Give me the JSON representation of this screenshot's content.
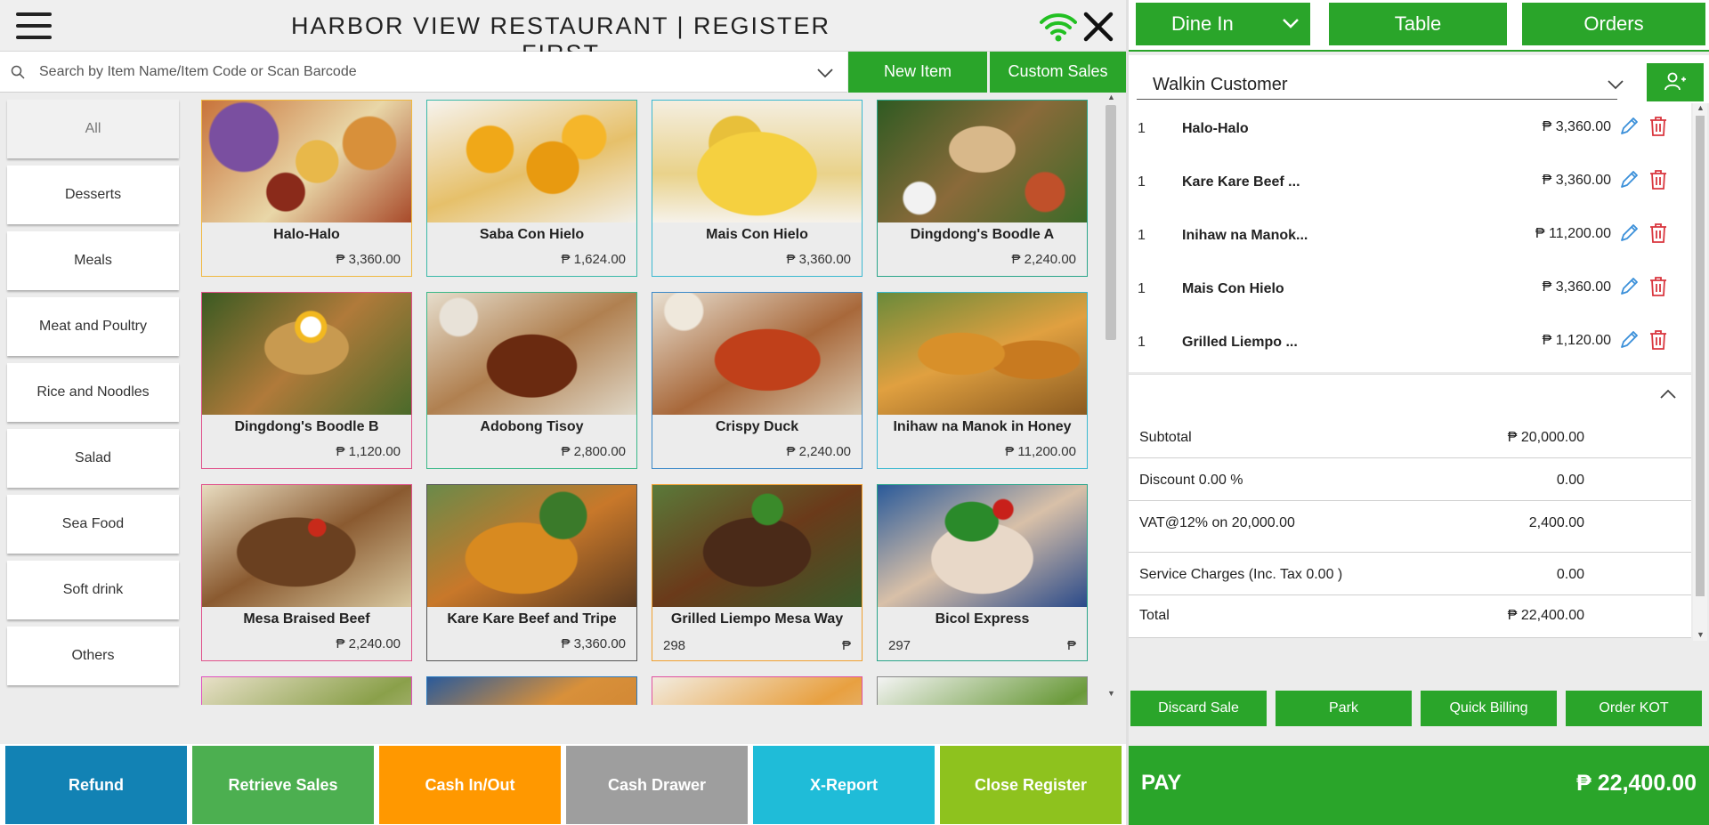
{
  "header": {
    "title": "HARBOR VIEW RESTAURANT | REGISTER FIRST"
  },
  "search": {
    "placeholder": "Search by Item Name/Item Code or Scan Barcode",
    "value": ""
  },
  "toolbar": {
    "new_item": "New Item",
    "custom_sales": "Custom Sales"
  },
  "categories": [
    "All",
    "Desserts",
    "Meals",
    "Meat and Poultry",
    "Rice and Noodles",
    "Salad",
    "Sea Food",
    "Soft drink",
    "Others"
  ],
  "items": [
    {
      "name": "Halo-Halo",
      "price": "₱ 3,360.00"
    },
    {
      "name": "Saba Con Hielo",
      "price": "₱ 1,624.00"
    },
    {
      "name": "Mais Con Hielo",
      "price": "₱ 3,360.00"
    },
    {
      "name": "Dingdong's Boodle A",
      "price": "₱ 2,240.00"
    },
    {
      "name": "Dingdong's Boodle B",
      "price": "₱ 1,120.00"
    },
    {
      "name": "Adobong Tisoy",
      "price": "₱ 2,800.00"
    },
    {
      "name": "Crispy Duck",
      "price": "₱ 2,240.00"
    },
    {
      "name": "Inihaw na Manok in Honey",
      "price": "₱ 11,200.00"
    },
    {
      "name": "Mesa Braised Beef",
      "price": "₱ 2,240.00"
    },
    {
      "name": "Kare Kare Beef and Tripe",
      "price": "₱ 3,360.00"
    },
    {
      "name": "Grilled Liempo Mesa Way",
      "code": "298",
      "currency": "₱"
    },
    {
      "name": "Bicol Express",
      "code": "297",
      "currency": "₱"
    }
  ],
  "actions": {
    "refund": "Refund",
    "retrieve_sales": "Retrieve Sales",
    "cash_in_out": "Cash In/Out",
    "cash_drawer": "Cash Drawer",
    "x_report": "X-Report",
    "close_register": "Close Register"
  },
  "order": {
    "mode": "Dine In",
    "table": "Table",
    "orders": "Orders",
    "customer": "Walkin Customer",
    "lines": [
      {
        "qty": "1",
        "name": "Halo-Halo",
        "price": "₱ 3,360.00"
      },
      {
        "qty": "1",
        "name": "Kare Kare Beef ...",
        "price": "₱ 3,360.00"
      },
      {
        "qty": "1",
        "name": "Inihaw na Manok...",
        "price": "₱ 11,200.00"
      },
      {
        "qty": "1",
        "name": "Mais Con Hielo",
        "price": "₱ 3,360.00"
      },
      {
        "qty": "1",
        "name": "Grilled Liempo ...",
        "price": "₱ 1,120.00"
      }
    ],
    "totals": {
      "subtotal_label": "Subtotal",
      "subtotal": "₱ 20,000.00",
      "discount_label": "Discount 0.00 %",
      "discount": "0.00",
      "vat_label": "VAT@12% on 20,000.00",
      "vat": "2,400.00",
      "service_label": "Service Charges (Inc. Tax 0.00 )",
      "service": "0.00",
      "total_label": "Total",
      "total": "₱ 22,400.00"
    },
    "buttons": {
      "discard": "Discard Sale",
      "park": "Park",
      "quick_billing": "Quick Billing",
      "order_kot": "Order KOT"
    },
    "pay_label": "PAY",
    "pay_amount": "₱ 22,400.00"
  },
  "colors": {
    "accent": "#2aa52a",
    "refund": "#1282b4",
    "retrieve": "#4caf50",
    "cash_in_out": "#ff9800",
    "cash_drawer": "#9e9e9e",
    "x_report": "#1fbcd8",
    "close_register": "#8ec21e",
    "delete": "#d9363e",
    "edit": "#3a8fd9"
  },
  "icons": {
    "menu": "hamburger-icon",
    "wifi": "wifi-icon",
    "close": "close-icon",
    "search": "search-icon",
    "add_customer": "add-user-icon",
    "edit": "pencil-icon",
    "delete": "trash-icon"
  }
}
